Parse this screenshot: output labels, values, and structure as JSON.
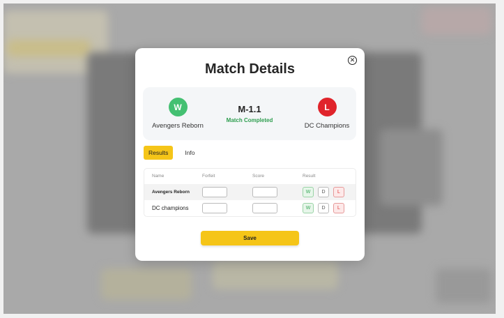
{
  "modal": {
    "title": "Match Details",
    "close_icon": "close-circle-icon"
  },
  "match": {
    "id": "M-1.1",
    "status": "Match Completed",
    "status_color": "#2e9e4f",
    "home": {
      "name": "Avengers Reborn",
      "badge": "W",
      "badge_color": "#44c072"
    },
    "away": {
      "name": "DC Champions",
      "badge": "L",
      "badge_color": "#e0242b"
    }
  },
  "tabs": [
    {
      "label": "Results",
      "active": true
    },
    {
      "label": "Info",
      "active": false
    }
  ],
  "table": {
    "headers": [
      "Name",
      "Forfeit",
      "Score",
      "Result"
    ],
    "rows": [
      {
        "name": "Avengers Reborn",
        "forfeit": "",
        "score": "",
        "results": [
          "W",
          "D",
          "L"
        ]
      },
      {
        "name": "DC champions",
        "forfeit": "",
        "score": "",
        "results": [
          "W",
          "D",
          "L"
        ]
      }
    ]
  },
  "save_label": "Save",
  "colors": {
    "accent": "#f5c518",
    "win": "#44c072",
    "loss": "#e0242b"
  }
}
